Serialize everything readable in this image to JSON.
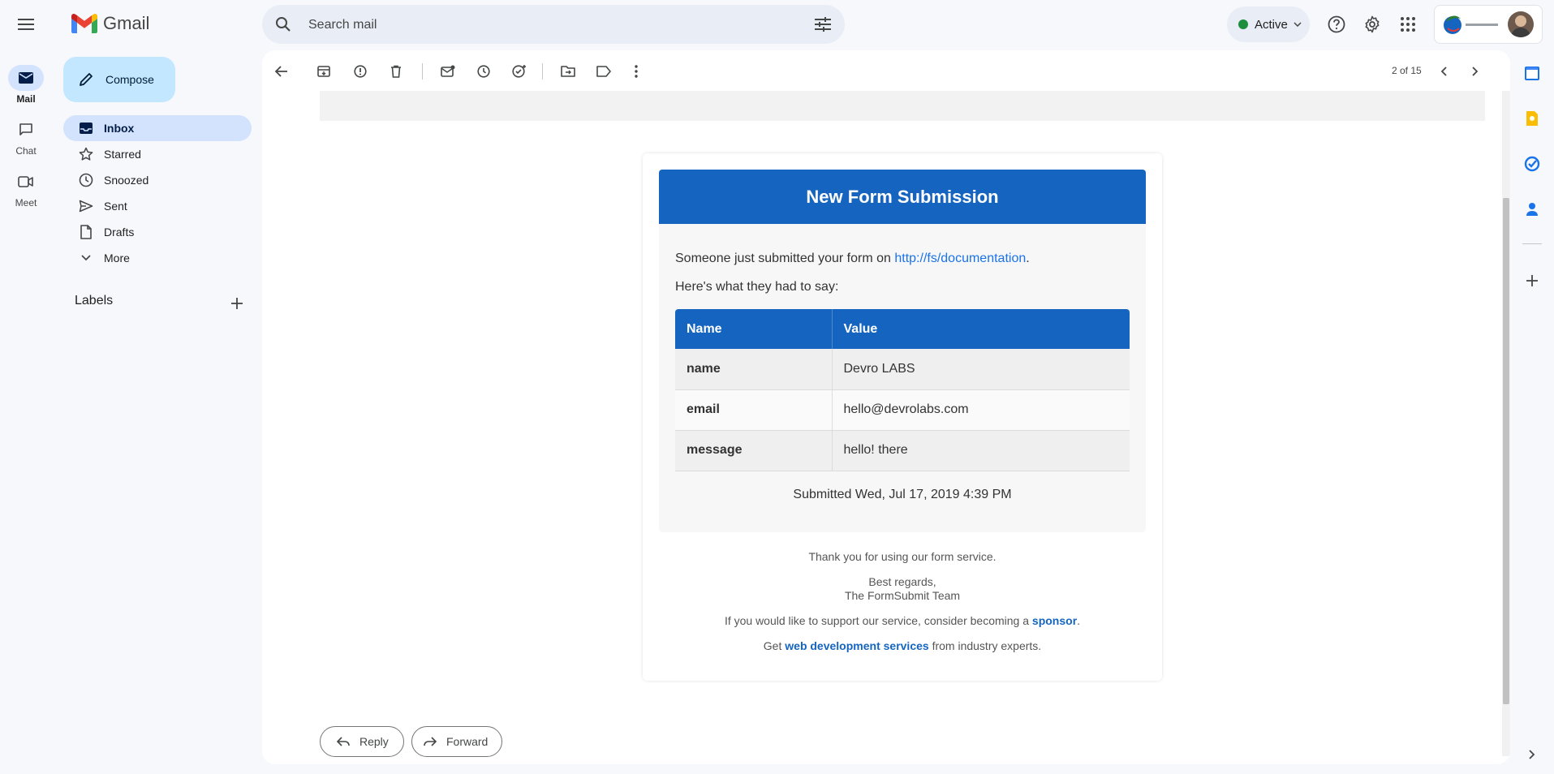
{
  "app": {
    "name": "Gmail"
  },
  "rail": [
    {
      "label": "Mail",
      "icon": "mail-icon"
    },
    {
      "label": "Chat",
      "icon": "chat-icon"
    },
    {
      "label": "Meet",
      "icon": "meet-icon"
    }
  ],
  "search": {
    "placeholder": "Search mail"
  },
  "status": {
    "label": "Active",
    "color": "#1e8e3e"
  },
  "compose": {
    "label": "Compose"
  },
  "nav": [
    {
      "label": "Inbox",
      "icon": "inbox-icon",
      "active": true
    },
    {
      "label": "Starred",
      "icon": "star-icon"
    },
    {
      "label": "Snoozed",
      "icon": "clock-icon"
    },
    {
      "label": "Sent",
      "icon": "send-icon"
    },
    {
      "label": "Drafts",
      "icon": "draft-icon"
    },
    {
      "label": "More",
      "icon": "chevron-down-icon"
    }
  ],
  "labels": {
    "title": "Labels"
  },
  "pager": {
    "text": "2 of 15"
  },
  "email": {
    "header": "New Form Submission",
    "intro_prefix": "Someone just submitted your form on ",
    "intro_link": "http://fs/documentation",
    "intro_suffix": ".",
    "subtitle": "Here's what they had to say:",
    "table": {
      "headers": [
        "Name",
        "Value"
      ],
      "rows": [
        [
          "name",
          "Devro LABS"
        ],
        [
          "email",
          "hello@devrolabs.com"
        ],
        [
          "message",
          "hello! there"
        ]
      ]
    },
    "submitted": "Submitted Wed, Jul 17, 2019 4:39 PM",
    "thanks": "Thank you for using our form service.",
    "regards": "Best regards,",
    "team": "The FormSubmit Team",
    "sponsor_prefix": "If you would like to support our service, consider becoming a ",
    "sponsor_link": "sponsor",
    "sponsor_suffix": ".",
    "services_prefix": "Get ",
    "services_link": "web development services",
    "services_suffix": " from industry experts."
  },
  "actions": {
    "reply": "Reply",
    "forward": "Forward"
  },
  "colors": {
    "accent": "#1565c0",
    "nav_active": "#d3e3fd",
    "compose_bg": "#c2e7ff"
  }
}
